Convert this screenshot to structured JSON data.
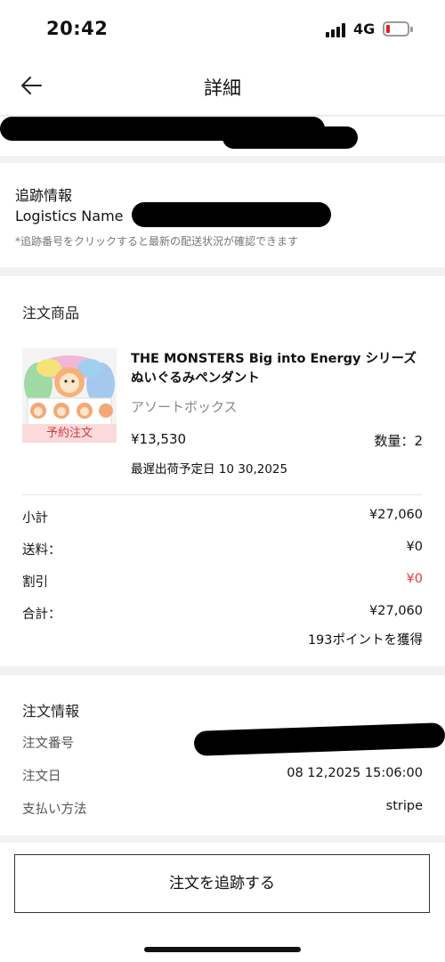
{
  "status_bar": {
    "time": "20:42",
    "network": "4G"
  },
  "header": {
    "title": "詳細"
  },
  "tracking": {
    "title": "追跡情報",
    "logistics_label": "Logistics Name",
    "note": "*追跡番号をクリックすると最新の配送状況が確認できます"
  },
  "products": {
    "title": "注文商品",
    "item": {
      "name": "THE MONSTERS Big into Energy シリーズ ぬいぐるみペンダント",
      "variant": "アソートボックス",
      "badge": "予約注文",
      "price": "¥13,530",
      "quantity": "数量：2",
      "shipping_date": "最遅出荷予定日 10 30,2025"
    },
    "summary": [
      {
        "label": "小計",
        "value": "¥27,060"
      },
      {
        "label": "送料：",
        "value": "¥0"
      },
      {
        "label": "割引",
        "value": "¥0"
      },
      {
        "label": "合計：",
        "value": "¥27,060"
      }
    ],
    "points": "193ポイントを獲得"
  },
  "order_info": {
    "title": "注文情報",
    "rows": [
      {
        "label": "注文番号",
        "value": ""
      },
      {
        "label": "注文日",
        "value": "08 12,2025 15:06:00"
      },
      {
        "label": "支払い方法",
        "value": "stripe"
      }
    ]
  },
  "actions": {
    "track_button": "注文を追跡する"
  },
  "colors": {
    "discount": "#e03a3a",
    "badge_bg": "#fbdada",
    "badge_text": "#d33a3a"
  }
}
